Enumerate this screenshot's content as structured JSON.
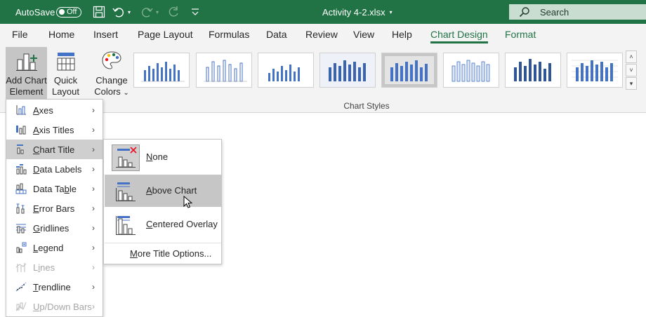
{
  "title_bar": {
    "autosave_label": "AutoSave",
    "autosave_state": "Off",
    "document_title": "Activity 4-2.xlsx",
    "search_placeholder": "Search"
  },
  "ribbon_tabs": [
    {
      "label": "File"
    },
    {
      "label": "Home"
    },
    {
      "label": "Insert"
    },
    {
      "label": "Page Layout"
    },
    {
      "label": "Formulas"
    },
    {
      "label": "Data"
    },
    {
      "label": "Review"
    },
    {
      "label": "View"
    },
    {
      "label": "Help"
    },
    {
      "label": "Chart Design",
      "active": true
    },
    {
      "label": "Format"
    }
  ],
  "ribbon": {
    "add_chart_element": {
      "line1": "Add Chart",
      "line2": "Element",
      "chevron": "⌄"
    },
    "quick_layout": {
      "line1": "Quick",
      "line2": "Layout",
      "chevron": "⌄"
    },
    "change_colors": {
      "line1": "Change",
      "line2": "Colors",
      "chevron": "⌄"
    },
    "chart_styles_label": "Chart Styles",
    "selected_style_index": 5
  },
  "chart_element_menu": {
    "items": [
      {
        "label": "Axes",
        "accel": "A",
        "rest": "xes",
        "icon": "axes-icon",
        "enabled": true
      },
      {
        "label": "Axis Titles",
        "accel": "A",
        "rest": "xis Titles",
        "icon": "axis-titles-icon",
        "enabled": true
      },
      {
        "label": "Chart Title",
        "accel": "C",
        "rest": "hart Title",
        "icon": "chart-title-icon",
        "enabled": true,
        "highlighted": true
      },
      {
        "label": "Data Labels",
        "accel": "D",
        "rest": "ata Labels",
        "icon": "data-labels-icon",
        "enabled": true
      },
      {
        "label": "Data Table",
        "pre": "Data Ta",
        "accel": "b",
        "rest": "le",
        "icon": "data-table-icon",
        "enabled": true
      },
      {
        "label": "Error Bars",
        "accel": "E",
        "rest": "rror Bars",
        "icon": "error-bars-icon",
        "enabled": true
      },
      {
        "label": "Gridlines",
        "accel": "G",
        "rest": "ridlines",
        "icon": "gridlines-icon",
        "enabled": true
      },
      {
        "label": "Legend",
        "accel": "L",
        "rest": "egend",
        "icon": "legend-icon",
        "enabled": true
      },
      {
        "label": "Lines",
        "pre": "L",
        "accel": "i",
        "rest": "nes",
        "icon": "lines-icon",
        "enabled": false
      },
      {
        "label": "Trendline",
        "accel": "T",
        "rest": "rendline",
        "icon": "trendline-icon",
        "enabled": true
      },
      {
        "label": "Up/Down Bars",
        "accel": "U",
        "rest": "p/Down Bars",
        "icon": "up-down-bars-icon",
        "enabled": false
      }
    ],
    "arrow": "›"
  },
  "chart_title_submenu": {
    "items": [
      {
        "label": "None",
        "accel": "N",
        "rest": "one",
        "icon": "chart-title-none-icon"
      },
      {
        "label": "Above Chart",
        "accel": "A",
        "rest": "bove Chart",
        "icon": "chart-title-above-icon",
        "highlighted": true
      },
      {
        "label": "Centered Overlay",
        "accel": "C",
        "rest": "entered Overlay",
        "icon": "chart-title-overlay-icon"
      }
    ],
    "more_options": {
      "label": "More Title Options...",
      "accel": "M",
      "rest": "ore Title Options..."
    }
  },
  "colors": {
    "excel_green": "#217346",
    "menu_highlight": "#cfcfcf",
    "chart_blue": "#4472c4",
    "delete_red": "#e81123"
  }
}
